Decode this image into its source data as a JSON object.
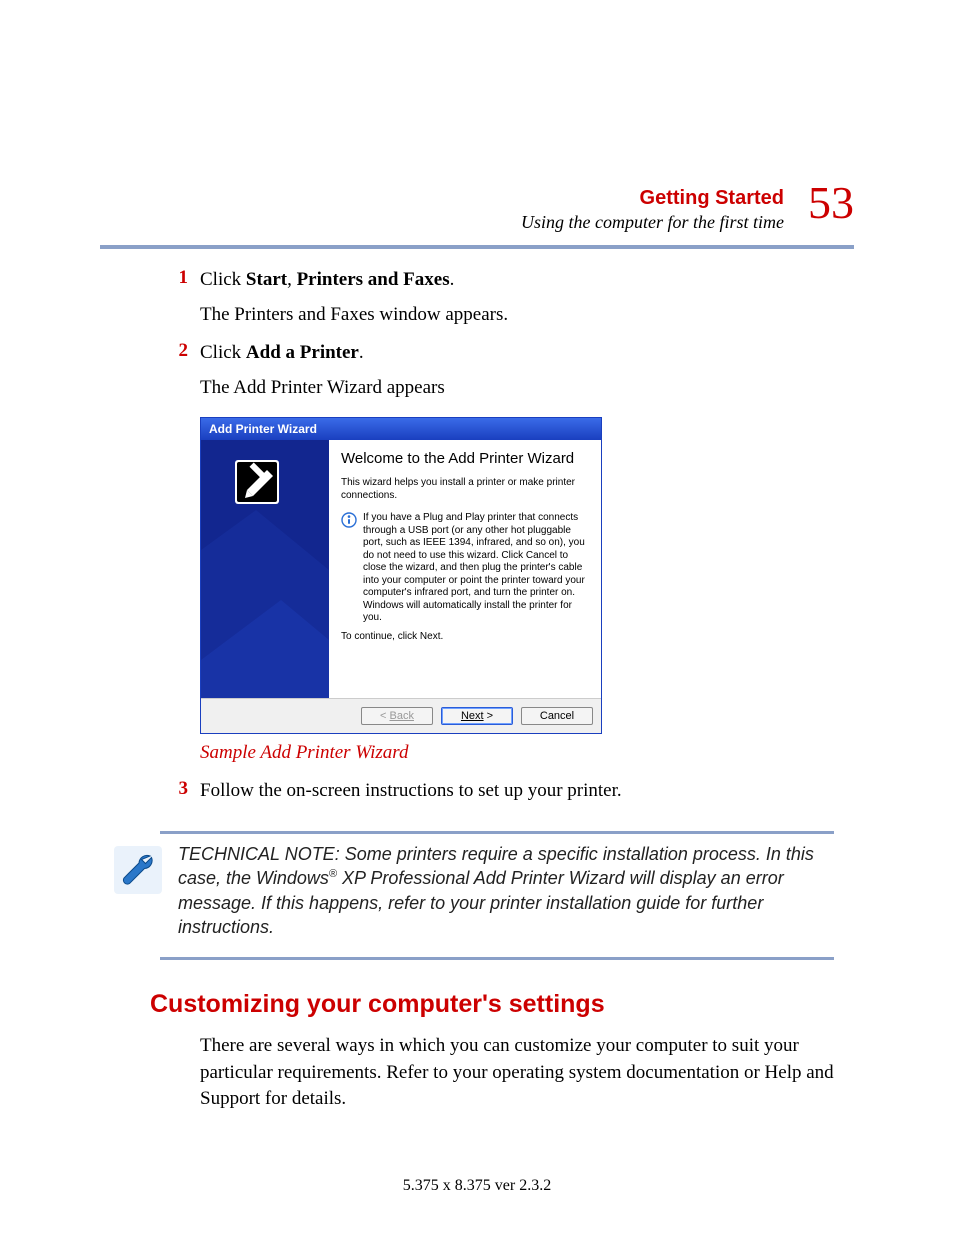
{
  "header": {
    "chapter": "Getting Started",
    "subtitle": "Using the computer for the first time",
    "page_number": "53"
  },
  "steps": [
    {
      "num": "1",
      "line_prefix": "Click ",
      "bold1": "Start",
      "mid": ", ",
      "bold2": "Printers and Faxes",
      "suffix": ".",
      "follow": "The Printers and Faxes window appears."
    },
    {
      "num": "2",
      "line_prefix": "Click ",
      "bold1": "Add a Printer",
      "mid": "",
      "bold2": "",
      "suffix": ".",
      "follow": "The Add Printer Wizard appears"
    },
    {
      "num": "3",
      "line_prefix": "Follow the on-screen instructions to set up your printer.",
      "bold1": "",
      "mid": "",
      "bold2": "",
      "suffix": "",
      "follow": ""
    }
  ],
  "wizard": {
    "title": "Add Printer Wizard",
    "heading": "Welcome to the Add Printer Wizard",
    "intro": "This wizard helps you install a printer or make printer connections.",
    "info": "If you have a Plug and Play printer that connects through a USB port (or any other hot pluggable port, such as IEEE 1394, infrared, and so on), you do not need to use this wizard. Click Cancel to close the wizard, and then plug the printer's cable into your computer or point the printer toward your computer's infrared port, and turn the printer on. Windows will automatically install the printer for you.",
    "cont": "To continue, click Next.",
    "buttons": {
      "back_label": "< ",
      "back_text": "Back",
      "next_text": "Next",
      "next_suffix": " >",
      "cancel": "Cancel"
    }
  },
  "figure_caption": "Sample Add Printer Wizard",
  "note": {
    "label": "TECHNICAL NOTE:",
    "text_before": " Some printers require a specific installation process. In this case, the Windows",
    "reg": "®",
    "text_after": " XP Professional Add Printer Wizard will display an error message. If this happens, refer to your printer installation guide for further instructions."
  },
  "section_heading": "Customizing your computer's settings",
  "section_body": "There are several ways in which you can customize your computer to suit your particular requirements. Refer to your operating system documentation or Help and Support for details.",
  "footer": "5.375 x 8.375 ver 2.3.2"
}
